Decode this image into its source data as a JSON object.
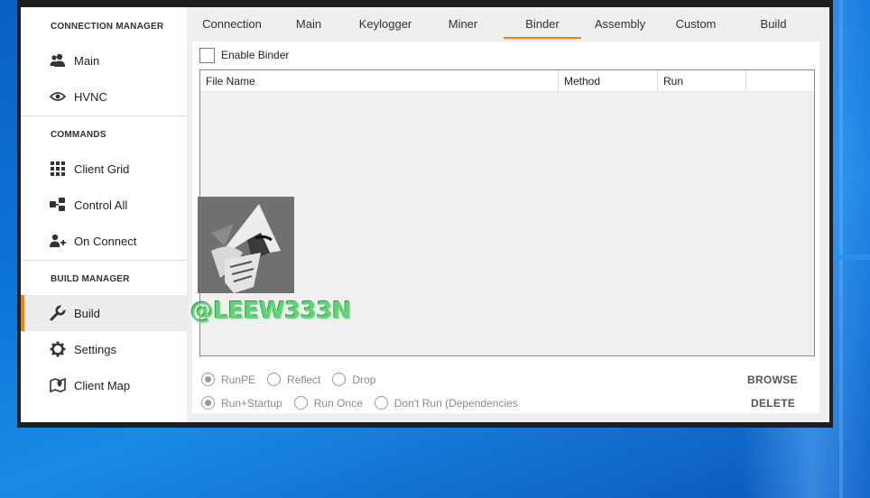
{
  "sidebar": {
    "sections": [
      {
        "title": "CONNECTION MANAGER",
        "items": [
          {
            "label": "Main",
            "icon": "users-icon"
          },
          {
            "label": "HVNC",
            "icon": "eye-icon"
          }
        ]
      },
      {
        "title": "COMMANDS",
        "items": [
          {
            "label": "Client Grid",
            "icon": "grid-icon"
          },
          {
            "label": "Control All",
            "icon": "network-icon"
          },
          {
            "label": "On Connect",
            "icon": "add-user-icon"
          }
        ]
      },
      {
        "title": "BUILD MANAGER",
        "items": [
          {
            "label": "Build",
            "icon": "wrench-icon",
            "active": true
          },
          {
            "label": "Settings",
            "icon": "gear-icon"
          },
          {
            "label": "Client Map",
            "icon": "map-icon"
          }
        ]
      }
    ]
  },
  "tabs": [
    "Connection",
    "Main",
    "Keylogger",
    "Miner",
    "Binder",
    "Assembly",
    "Custom",
    "Build"
  ],
  "active_tab": "Binder",
  "binder": {
    "enable_label": "Enable Binder",
    "enabled": false,
    "columns": [
      "File Name",
      "Method",
      "Run",
      ""
    ],
    "rows": [],
    "method_options": [
      {
        "label": "RunPE",
        "checked": true
      },
      {
        "label": "Reflect",
        "checked": false
      },
      {
        "label": "Drop",
        "checked": false
      }
    ],
    "run_options": [
      {
        "label": "Run+Startup",
        "checked": true
      },
      {
        "label": "Run Once",
        "checked": false
      },
      {
        "label": "Don't Run (Dependencies",
        "checked": false
      }
    ],
    "browse_label": "BROWSE",
    "delete_label": "DELETE"
  },
  "watermark": {
    "text": "@LEEW333N"
  },
  "colors": {
    "accent": "#f08010",
    "desktop": "#0d74d8"
  }
}
